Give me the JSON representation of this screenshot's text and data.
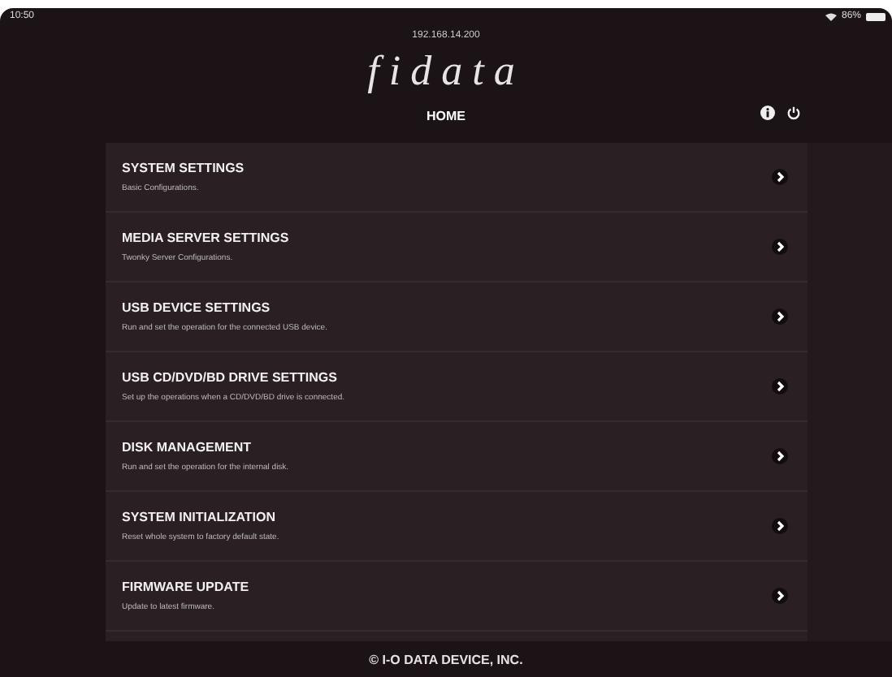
{
  "status_bar": {
    "time": "10:50",
    "battery": "86%"
  },
  "address": "192.168.14.200",
  "logo": "fidata",
  "header": {
    "title": "HOME"
  },
  "menu": [
    {
      "title": "SYSTEM SETTINGS",
      "description": "Basic Configurations."
    },
    {
      "title": "MEDIA SERVER SETTINGS",
      "description": "Twonky Server Configurations."
    },
    {
      "title": "USB DEVICE SETTINGS",
      "description": "Run and set the operation for the connected USB device."
    },
    {
      "title": "USB CD/DVD/BD DRIVE SETTINGS",
      "description": "Set up the operations when a CD/DVD/BD drive is connected."
    },
    {
      "title": "DISK MANAGEMENT",
      "description": "Run and set the operation for the internal disk."
    },
    {
      "title": "SYSTEM INITIALIZATION",
      "description": "Reset whole system to factory default state."
    },
    {
      "title": "FIRMWARE UPDATE",
      "description": "Update to latest firmware."
    }
  ],
  "footer": "© I-O DATA DEVICE, INC."
}
